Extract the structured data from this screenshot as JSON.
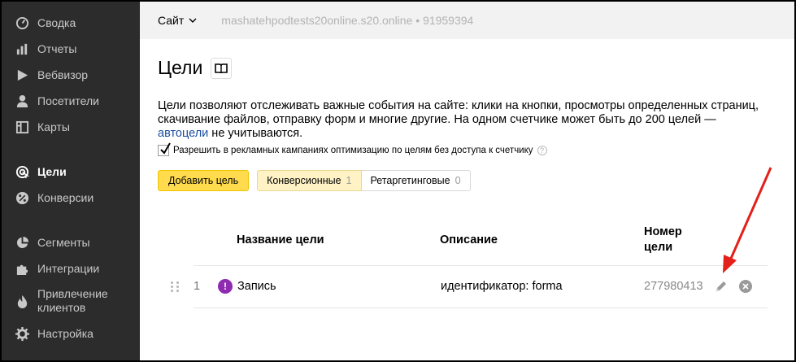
{
  "sidebar": {
    "items": [
      {
        "label": "Сводка",
        "icon": "gauge-icon"
      },
      {
        "label": "Отчеты",
        "icon": "bar-chart-icon"
      },
      {
        "label": "Вебвизор",
        "icon": "play-icon"
      },
      {
        "label": "Посетители",
        "icon": "person-icon"
      },
      {
        "label": "Карты",
        "icon": "map-icon"
      },
      {
        "label": "Цели",
        "icon": "target-icon",
        "active": true
      },
      {
        "label": "Конверсии",
        "icon": "percent-icon"
      },
      {
        "label": "Сегменты",
        "icon": "pie-icon"
      },
      {
        "label": "Интеграции",
        "icon": "puzzle-icon"
      },
      {
        "label": "Привлечение клиентов",
        "icon": "flame-icon"
      },
      {
        "label": "Настройка",
        "icon": "gear-icon"
      }
    ]
  },
  "header": {
    "site_label": "Сайт",
    "site_url": "mashatehpodtests20online.s20.online • 91959394"
  },
  "page": {
    "title": "Цели",
    "description_before": "Цели позволяют отслеживать важные события на сайте: клики на кнопки, просмотры определенных страниц, скачивание файлов, отправку форм и многие другие. На одном счетчике может быть до 200 целей — ",
    "description_link": "автоцели",
    "description_after": " не учитываются.",
    "option_label": "Разрешить в рекламных кампаниях оптимизацию по целям без доступа к счетчику",
    "option_checked": true,
    "help_glyph": "?",
    "add_button": "Добавить цель",
    "tabs": [
      {
        "label": "Конверсионные",
        "count": "1",
        "active": true
      },
      {
        "label": "Ретаргетинговые",
        "count": "0",
        "active": false
      }
    ]
  },
  "table": {
    "headers": {
      "name": "Название цели",
      "description": "Описание",
      "number_line1": "Номер",
      "number_line2": "цели"
    },
    "rows": [
      {
        "index": "1",
        "icon_glyph": "!",
        "name": "Запись",
        "description": "идентификатор: forma",
        "number": "277980413"
      }
    ]
  },
  "colors": {
    "sidebar_bg": "#2c2c2c",
    "accent_yellow": "#ffdb4d",
    "goal_icon": "#8e2bb0",
    "link": "#1a4d9e",
    "annotation_arrow": "#e3201b"
  }
}
